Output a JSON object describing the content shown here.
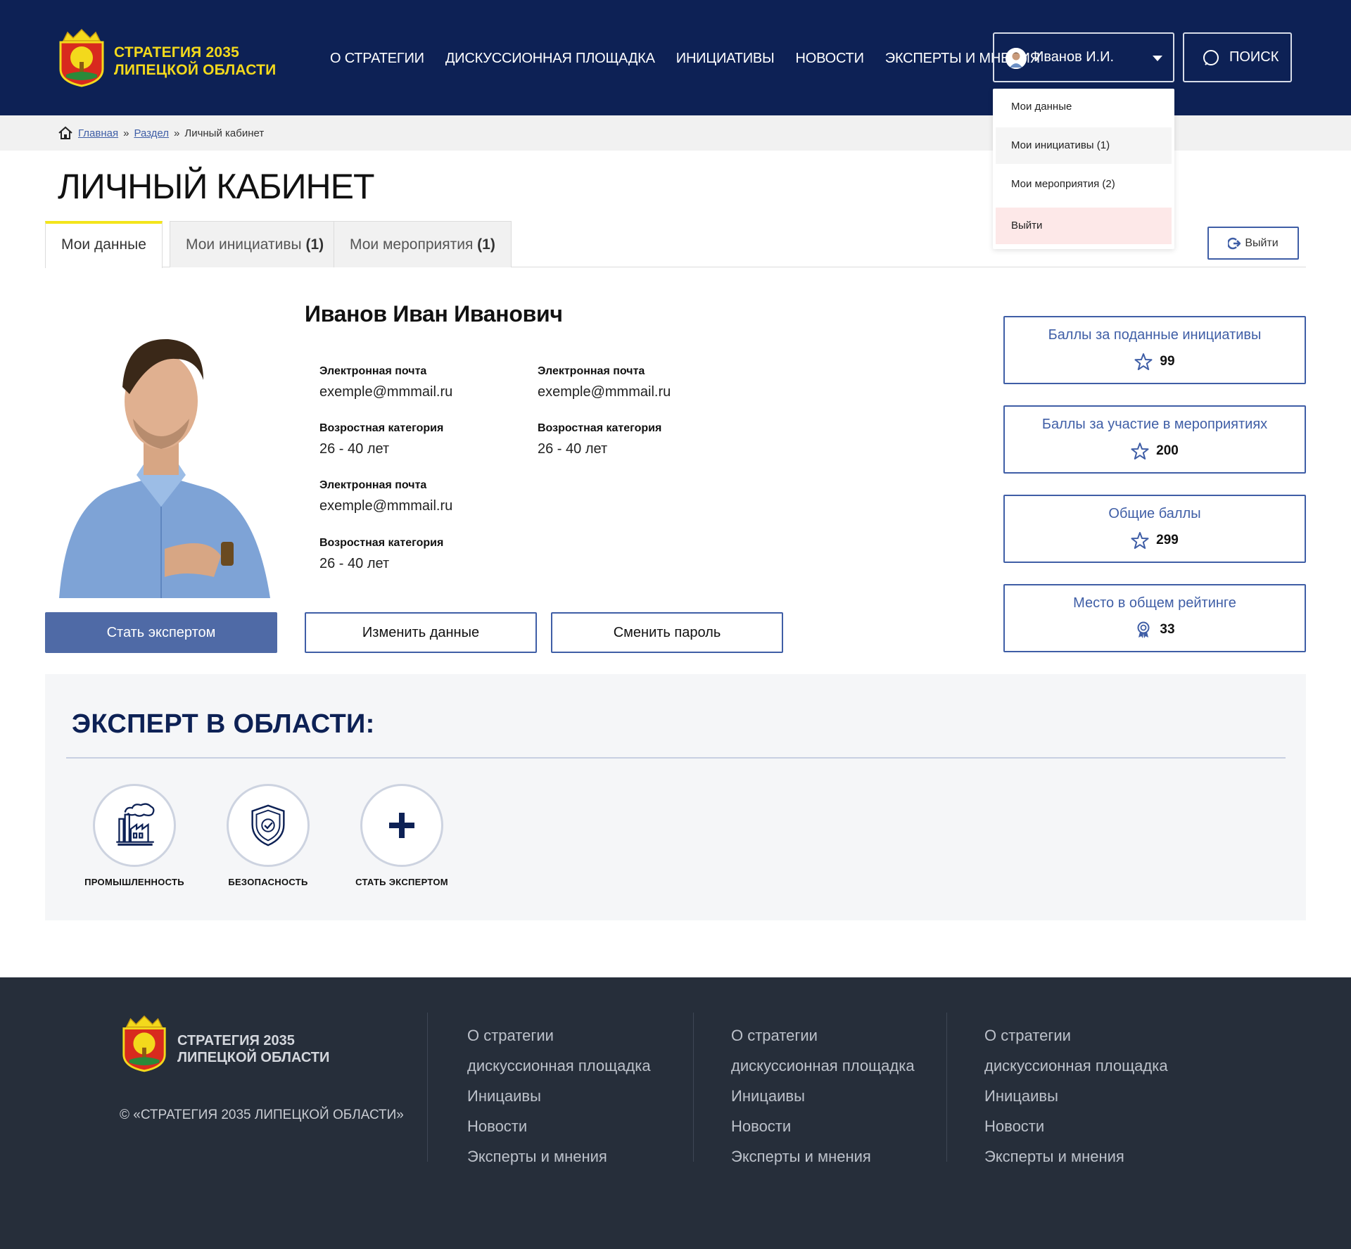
{
  "header": {
    "logo_line1": "СТРАТЕГИЯ 2035",
    "logo_line2": "ЛИПЕЦКОЙ ОБЛАСТИ",
    "nav": [
      "О СТРАТЕГИИ",
      "ДИСКУССИОННАЯ ПЛОЩАДКА",
      "ИНИЦИАТИВЫ",
      "НОВОСТИ",
      "ЭКСПЕРТЫ И МНЕНИЯ"
    ],
    "user_name": "Иванов И.И.",
    "search_label": "ПОИСК"
  },
  "user_menu": {
    "items": [
      "Мои данные",
      "Мои инициативы (1)",
      "Мои мероприятия (2)",
      "Выйти"
    ]
  },
  "breadcrumb": {
    "home": "Главная",
    "section": "Раздел",
    "current": "Личный кабинет",
    "separator": "»"
  },
  "page": {
    "title": "ЛИЧНЫЙ КАБИНЕТ",
    "tabs": [
      {
        "label": "Мои данные",
        "count": ""
      },
      {
        "label": "Мои инициативы",
        "count": "(1)"
      },
      {
        "label": "Мои мероприятия",
        "count": "(1)"
      }
    ],
    "logout_label": "Выйти"
  },
  "profile": {
    "full_name": "Иванов Иван Иванович",
    "fields": [
      {
        "label": "Электронная почта",
        "value": "exemple@mmmail.ru"
      },
      {
        "label": "Электронная почта",
        "value": "exemple@mmmail.ru"
      },
      {
        "label": "Возростная категория",
        "value": "26 - 40 лет"
      },
      {
        "label": "Возростная категория",
        "value": "26 - 40 лет"
      },
      {
        "label": "Электронная почта",
        "value": "exemple@mmmail.ru"
      },
      {
        "label": "Возростная категория",
        "value": "26 - 40 лет"
      }
    ],
    "become_expert_button": "Стать экспертом",
    "edit_button": "Изменить данные",
    "password_button": "Сменить пароль"
  },
  "scores": [
    {
      "label": "Баллы за поданные инициативы",
      "value": "99",
      "icon": "star-icon"
    },
    {
      "label": "Баллы за участие в мероприятиях",
      "value": "200",
      "icon": "star-icon"
    },
    {
      "label": "Общие баллы",
      "value": "299",
      "icon": "star-icon"
    },
    {
      "label": "Место в общем рейтинге",
      "value": "33",
      "icon": "award-icon"
    }
  ],
  "expert": {
    "title": "ЭКСПЕРТ В ОБЛАСТИ:",
    "items": [
      {
        "label": "ПРОМЫШЛЕННОСТЬ",
        "icon": "factory-icon"
      },
      {
        "label": "БЕЗОПАСНОСТЬ",
        "icon": "shield-icon"
      },
      {
        "label": "СТАТЬ ЭКСПЕРТОМ",
        "icon": "plus-icon"
      }
    ]
  },
  "footer": {
    "logo_line1": "СТРАТЕГИЯ 2035",
    "logo_line2": "ЛИПЕЦКОЙ ОБЛАСТИ",
    "copyright": "© «СТРАТЕГИЯ 2035 ЛИПЕЦКОЙ ОБЛАСТИ»",
    "columns": [
      [
        "О стратегии",
        "дискуссионная площадка",
        "Иницаивы",
        "Новости",
        "Эксперты и мнения"
      ],
      [
        "О стратегии",
        "дискуссионная площадка",
        "Иницаивы",
        "Новости",
        "Эксперты и мнения"
      ],
      [
        "О стратегии",
        "дискуссионная площадка",
        "Иницаивы",
        "Новости",
        "Эксперты и мнения"
      ]
    ]
  },
  "colors": {
    "header_bg": "#0d2155",
    "logo_yellow": "#f3d91c",
    "accent_blue": "#3f5ea6",
    "button_blue": "#4f6aa6",
    "footer_bg": "#262e3a",
    "logout_highlight": "#fde8e8"
  }
}
